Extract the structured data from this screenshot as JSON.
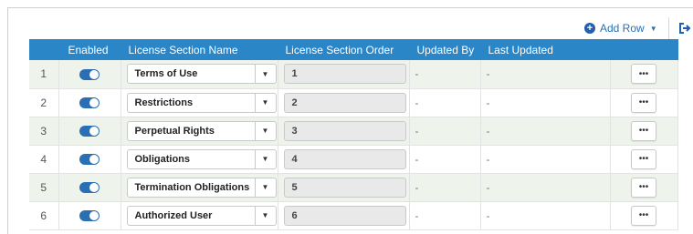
{
  "toolbar": {
    "add_row_label": "Add Row",
    "add_icon": "plus-circle-icon",
    "caret_icon": "caret-down-icon",
    "exit_icon": "sign-out-icon"
  },
  "table": {
    "headers": {
      "index": "",
      "enabled": "Enabled",
      "section_name": "License Section Name",
      "section_order": "License Section Order",
      "updated_by": "Updated By",
      "last_updated": "Last Updated",
      "actions": ""
    },
    "rows": [
      {
        "index": "1",
        "enabled": true,
        "section_name": "Terms of Use",
        "section_order": "1",
        "updated_by": "-",
        "last_updated": "-",
        "action_label": "•••"
      },
      {
        "index": "2",
        "enabled": true,
        "section_name": "Restrictions",
        "section_order": "2",
        "updated_by": "-",
        "last_updated": "-",
        "action_label": "•••"
      },
      {
        "index": "3",
        "enabled": true,
        "section_name": "Perpetual Rights",
        "section_order": "3",
        "updated_by": "-",
        "last_updated": "-",
        "action_label": "•••"
      },
      {
        "index": "4",
        "enabled": true,
        "section_name": "Obligations",
        "section_order": "4",
        "updated_by": "-",
        "last_updated": "-",
        "action_label": "•••"
      },
      {
        "index": "5",
        "enabled": true,
        "section_name": "Termination Obligations",
        "section_order": "5",
        "updated_by": "-",
        "last_updated": "-",
        "action_label": "•••"
      },
      {
        "index": "6",
        "enabled": true,
        "section_name": "Authorized User",
        "section_order": "6",
        "updated_by": "-",
        "last_updated": "-",
        "action_label": "•••"
      }
    ]
  },
  "colors": {
    "header_bg": "#2a86c7",
    "accent": "#1f5fae",
    "stripe_bg": "#eef4ec",
    "toggle_on": "#2a6fb3"
  }
}
